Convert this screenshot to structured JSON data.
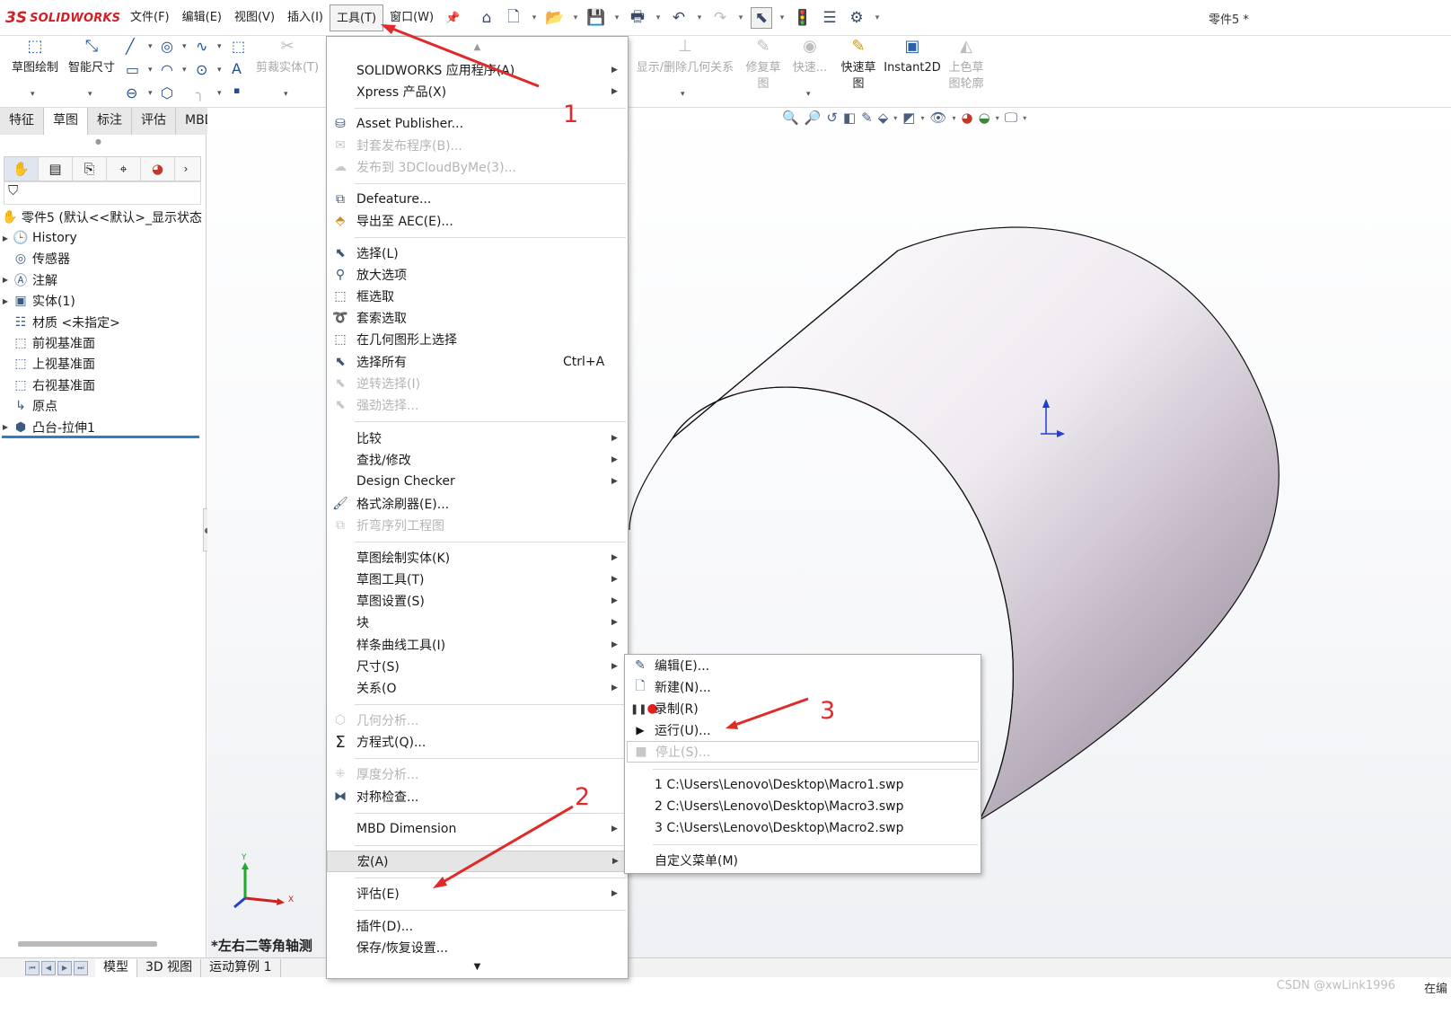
{
  "app": {
    "logo_symbol": "3S",
    "logo_text": "SOLIDWORKS",
    "document_title": "零件5 *"
  },
  "menubar": [
    {
      "label": "文件(F)"
    },
    {
      "label": "编辑(E)"
    },
    {
      "label": "视图(V)"
    },
    {
      "label": "插入(I)"
    },
    {
      "label": "工具(T)",
      "active": true
    },
    {
      "label": "窗口(W)"
    }
  ],
  "quickbar_icons": [
    "home-icon",
    "new-document-icon",
    "open-icon",
    "save-icon",
    "print-icon",
    "undo-icon",
    "redo-icon",
    "select-icon",
    "rebuild-icon",
    "file-properties-icon",
    "options-icon"
  ],
  "command_manager": {
    "sketch": "草图绘制",
    "smart_dimension": "智能尺寸",
    "trim": "剪裁实体(T)",
    "show_delete_relations": "显示/删除几何关系",
    "repair_sketch": "修复草图",
    "quick_snaps": "快速...",
    "rapid_sketch": "快速草图",
    "instant2d": "Instant2D",
    "shaded_sketch": "上色草图轮廓"
  },
  "tabs": [
    "特征",
    "草图",
    "标注",
    "评估",
    "MBD Dimensions"
  ],
  "active_tab": "草图",
  "feature_tree": {
    "root": "零件5  (默认<<默认>_显示状态",
    "items": [
      {
        "label": "History",
        "expandable": true,
        "icon": "history-icon"
      },
      {
        "label": "传感器",
        "expandable": false,
        "icon": "sensor-icon"
      },
      {
        "label": "注解",
        "expandable": true,
        "icon": "annotation-icon"
      },
      {
        "label": "实体(1)",
        "expandable": true,
        "icon": "solid-bodies-icon"
      },
      {
        "label": "材质 <未指定>",
        "expandable": false,
        "icon": "material-icon"
      },
      {
        "label": "前视基准面",
        "expandable": false,
        "icon": "plane-icon"
      },
      {
        "label": "上视基准面",
        "expandable": false,
        "icon": "plane-icon"
      },
      {
        "label": "右视基准面",
        "expandable": false,
        "icon": "plane-icon"
      },
      {
        "label": "原点",
        "expandable": false,
        "icon": "origin-icon"
      },
      {
        "label": "凸台-拉伸1",
        "expandable": true,
        "icon": "extrude-icon"
      }
    ]
  },
  "tools_menu": {
    "items": [
      {
        "label": "SOLIDWORKS 应用程序(A)",
        "submenu": true
      },
      {
        "label": "Xpress 产品(X)",
        "submenu": true
      },
      {
        "label": "Asset Publisher...",
        "icon": "asset-publisher-icon"
      },
      {
        "label": "封套发布程序(B)...",
        "disabled": true,
        "icon": "envelope-publisher-icon"
      },
      {
        "label": "发布到 3DCloudByMe(3)...",
        "disabled": true,
        "icon": "publish-cloud-icon"
      },
      {
        "label": "Defeature...",
        "icon": "defeature-icon"
      },
      {
        "label": "导出至 AEC(E)...",
        "icon": "export-aec-icon"
      },
      {
        "label": "选择(L)",
        "icon": "select-arrow-icon"
      },
      {
        "label": "放大选项",
        "icon": "magnify-select-icon"
      },
      {
        "label": "框选取",
        "icon": "box-select-icon"
      },
      {
        "label": "套索选取",
        "icon": "lasso-select-icon"
      },
      {
        "label": "在几何图形上选择",
        "icon": "select-over-geometry-icon"
      },
      {
        "label": "选择所有",
        "shortcut": "Ctrl+A",
        "icon": "select-all-icon"
      },
      {
        "label": "逆转选择(I)",
        "disabled": true,
        "icon": "invert-selection-icon"
      },
      {
        "label": "强劲选择...",
        "disabled": true,
        "icon": "power-select-icon"
      },
      {
        "label": "比较",
        "submenu": true
      },
      {
        "label": "查找/修改",
        "submenu": true
      },
      {
        "label": "Design Checker",
        "submenu": true
      },
      {
        "label": "格式涂刷器(E)...",
        "icon": "format-painter-icon"
      },
      {
        "label": "折弯序列工程图",
        "disabled": true,
        "icon": "bend-sequence-icon"
      },
      {
        "label": "草图绘制实体(K)",
        "submenu": true
      },
      {
        "label": "草图工具(T)",
        "submenu": true
      },
      {
        "label": "草图设置(S)",
        "submenu": true
      },
      {
        "label": "块",
        "submenu": true
      },
      {
        "label": "样条曲线工具(I)",
        "submenu": true
      },
      {
        "label": "尺寸(S)",
        "submenu": true
      },
      {
        "label": "关系(O",
        "submenu": true
      },
      {
        "label": "几何分析...",
        "disabled": true,
        "icon": "geometry-analysis-icon"
      },
      {
        "label": "方程式(Q)...",
        "icon": "sigma-icon"
      },
      {
        "label": "厚度分析...",
        "disabled": true,
        "icon": "thickness-analysis-icon"
      },
      {
        "label": "对称检查...",
        "icon": "symmetry-check-icon"
      },
      {
        "label": "MBD Dimension",
        "submenu": true
      },
      {
        "label": "宏(A)",
        "submenu": true,
        "highlighted": true
      },
      {
        "label": "评估(E)",
        "submenu": true
      },
      {
        "label": "插件(D)..."
      },
      {
        "label": "保存/恢复设置..."
      }
    ]
  },
  "macro_menu": {
    "items": [
      {
        "label": "编辑(E)...",
        "icon": "macro-edit-icon"
      },
      {
        "label": "新建(N)...",
        "icon": "macro-new-icon"
      },
      {
        "label": "录制(R)",
        "icon": "record-pause-icon"
      },
      {
        "label": "运行(U)...",
        "icon": "play-icon"
      },
      {
        "label": "停止(S)...",
        "icon": "stop-icon",
        "disabled": true
      },
      {
        "label": "1 C:\\Users\\Lenovo\\Desktop\\Macro1.swp"
      },
      {
        "label": "2 C:\\Users\\Lenovo\\Desktop\\Macro3.swp"
      },
      {
        "label": "3 C:\\Users\\Lenovo\\Desktop\\Macro2.swp"
      },
      {
        "label": "自定义菜单(M)"
      }
    ]
  },
  "viewport": {
    "view_label": "*左右二等角轴测",
    "triad_x": "X",
    "triad_y": "Y"
  },
  "bottom_tabs": [
    "模型",
    "3D 视图",
    "运动算例 1"
  ],
  "annotations": {
    "step1": "1",
    "step2": "2",
    "step3": "3",
    "color": "#e02a2a"
  },
  "statusbar": {
    "watermark": "CSDN @xwLink1996",
    "right_text": "在编"
  }
}
